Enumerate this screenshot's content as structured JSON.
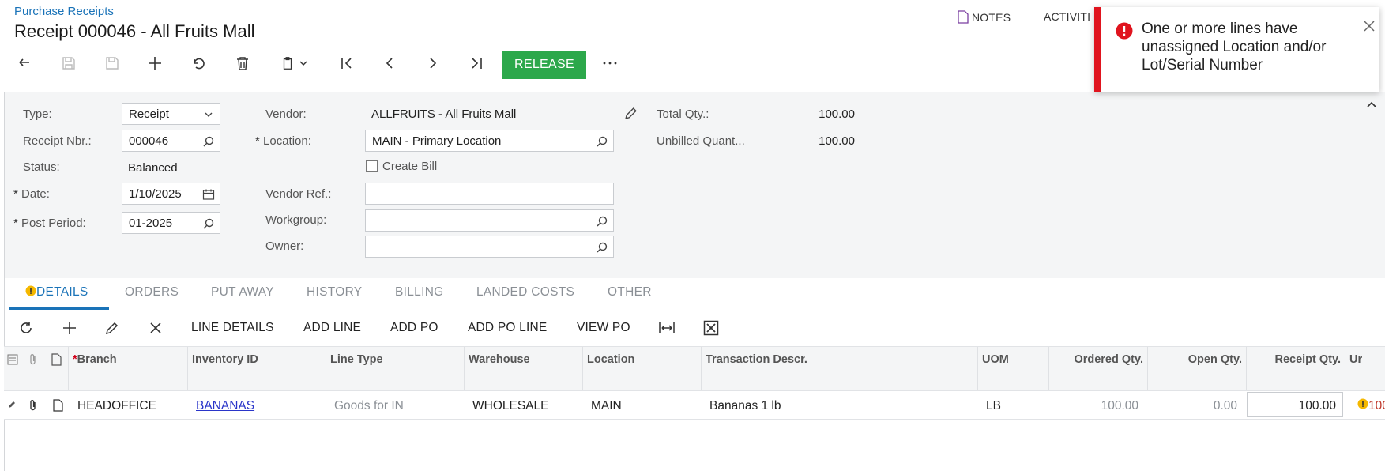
{
  "breadcrumb": "Purchase Receipts",
  "title": "Receipt 000046 - All Fruits Mall",
  "header_links": {
    "notes": "NOTES",
    "activities": "ACTIVITI"
  },
  "toolbar": {
    "release_label": "RELEASE"
  },
  "toast": {
    "message": "One or more lines have unassigned Location and/or Lot/Serial Number",
    "accent": "#e0141e"
  },
  "form": {
    "type_label": "Type:",
    "type_value": "Receipt",
    "receipt_nbr_label": "Receipt Nbr.:",
    "receipt_nbr_value": "000046",
    "status_label": "Status:",
    "status_value": "Balanced",
    "date_label": "Date:",
    "date_value": "1/10/2025",
    "post_period_label": "Post Period:",
    "post_period_value": "01-2025",
    "vendor_label": "Vendor:",
    "vendor_value": "ALLFRUITS - All Fruits Mall",
    "location_label": "Location:",
    "location_value": "MAIN - Primary Location",
    "create_bill_label": "Create Bill",
    "vendor_ref_label": "Vendor Ref.:",
    "vendor_ref_value": "",
    "workgroup_label": "Workgroup:",
    "workgroup_value": "",
    "owner_label": "Owner:",
    "owner_value": "",
    "total_qty_label": "Total Qty.:",
    "total_qty_value": "100.00",
    "unbilled_label": "Unbilled Quant...",
    "unbilled_value": "100.00",
    "required_mark": "*"
  },
  "tabs": [
    "DETAILS",
    "ORDERS",
    "PUT AWAY",
    "HISTORY",
    "BILLING",
    "LANDED COSTS",
    "OTHER"
  ],
  "grid_toolbar": [
    "LINE DETAILS",
    "ADD LINE",
    "ADD PO",
    "ADD PO LINE",
    "VIEW PO"
  ],
  "grid": {
    "columns": [
      "Branch",
      "Inventory ID",
      "Line Type",
      "Warehouse",
      "Location",
      "Transaction Descr.",
      "UOM",
      "Ordered Qty.",
      "Open Qty.",
      "Receipt Qty.",
      "Ur"
    ],
    "row": {
      "branch": "HEADOFFICE",
      "inventory_id": "BANANAS",
      "line_type": "Goods for IN",
      "warehouse": "WHOLESALE",
      "location": "MAIN",
      "descr": "Bananas 1 lb",
      "uom": "LB",
      "ordered": "100.00",
      "open": "0.00",
      "receipt": "100.00",
      "unit_cut": "100"
    }
  },
  "colors": {
    "accent": "#1a73b8",
    "release": "#2ca84b",
    "warning": "#f5b800"
  }
}
